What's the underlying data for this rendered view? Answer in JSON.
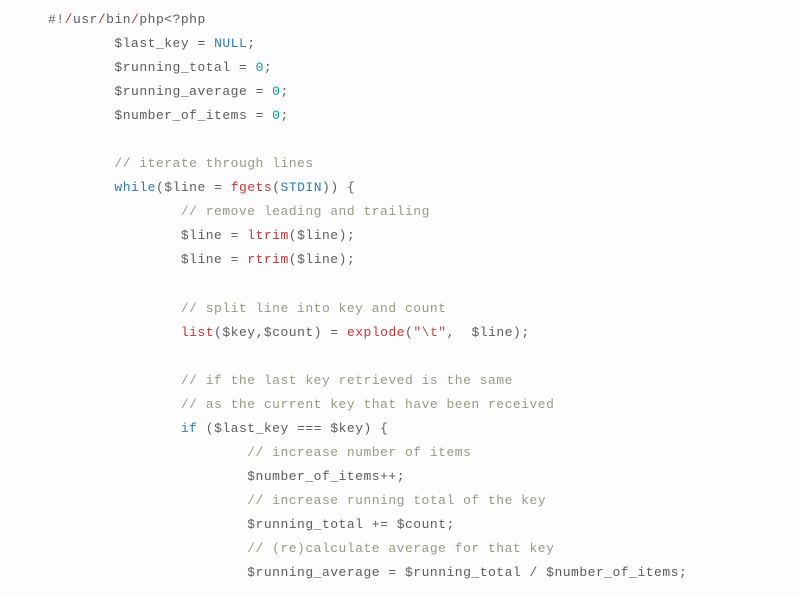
{
  "code": {
    "indent1": "        ",
    "indent2": "                ",
    "indent3": "                        ",
    "shebang_hash": "#",
    "shebang_bang": "!",
    "slash": "/",
    "usr": "usr",
    "bin": "bin",
    "php": "php",
    "php_open": "<?php",
    "dollar": "$",
    "var_last_key": "last_key",
    "var_running_total": "running_total",
    "var_running_average": "running_average",
    "var_number_of_items": "number_of_items",
    "var_line": "line",
    "var_key": "key",
    "var_count": "count",
    "eq": " = ",
    "eq_strict": " === ",
    "plus_eq": " += ",
    "div": " / ",
    "inc": "++",
    "null": "NULL",
    "zero": "0",
    "semi": ";",
    "comma": ",",
    "commasp": ",  ",
    "lparen": "(",
    "rparen": ")",
    "lbrace": " {",
    "comment_iterate": "// iterate through lines",
    "comment_remove": "// remove leading and trailing",
    "comment_split": "// split line into key and count",
    "comment_if_last1": "// if the last key retrieved is the same",
    "comment_if_last2": "// as the current key that have been received",
    "comment_inc_items": "// increase number of items",
    "comment_inc_total": "// increase running total of the key",
    "comment_recalc": "// (re)calculate average for that key",
    "kw_while": "while",
    "kw_if": "if",
    "kw_list": "list",
    "fn_fgets": "fgets",
    "fn_ltrim": "ltrim",
    "fn_rtrim": "rtrim",
    "fn_explode": "explode",
    "const_stdin": "STDIN",
    "str_tab": "\"\\t\"",
    "sp": " "
  }
}
